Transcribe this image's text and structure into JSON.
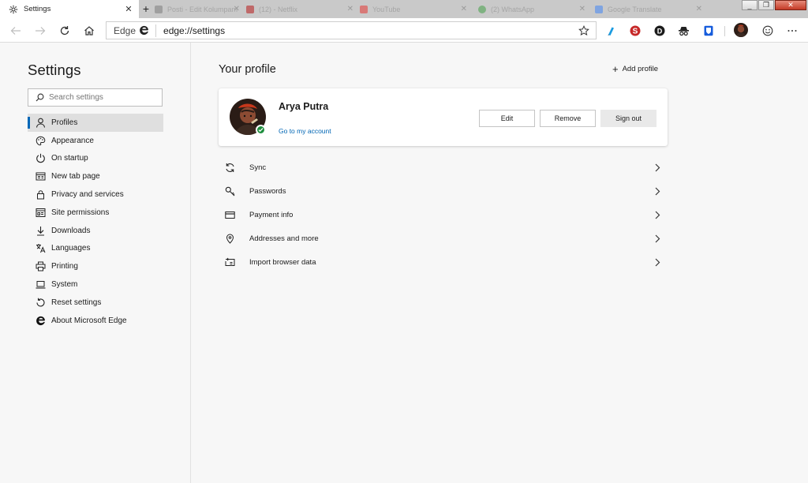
{
  "tabs": {
    "active": {
      "title": "Settings",
      "icon": "gear-icon"
    },
    "background": [
      {
        "title": "Posti - Edit Kolumpam",
        "color": "#7d7d7d"
      },
      {
        "title": "(12) - Netflix",
        "color": "#b71c1c"
      },
      {
        "title": "YouTube",
        "color": "#e53935"
      },
      {
        "title": "(2) WhatsApp",
        "color": "#43a047"
      },
      {
        "title": "Google Translate",
        "color": "#4285f4"
      }
    ]
  },
  "window_controls": {
    "minimize": "_",
    "maximize": "❐",
    "close": "✕"
  },
  "address_bar": {
    "brand": "Edge",
    "url": "edge://settings"
  },
  "sidebar": {
    "heading": "Settings",
    "search_placeholder": "Search settings",
    "items": [
      {
        "label": "Profiles",
        "icon": "person-icon",
        "active": true
      },
      {
        "label": "Appearance",
        "icon": "palette-icon"
      },
      {
        "label": "On startup",
        "icon": "power-icon"
      },
      {
        "label": "New tab page",
        "icon": "newtab-icon"
      },
      {
        "label": "Privacy and services",
        "icon": "lock-icon"
      },
      {
        "label": "Site permissions",
        "icon": "site-permissions-icon"
      },
      {
        "label": "Downloads",
        "icon": "download-icon"
      },
      {
        "label": "Languages",
        "icon": "languages-icon"
      },
      {
        "label": "Printing",
        "icon": "printer-icon"
      },
      {
        "label": "System",
        "icon": "laptop-icon"
      },
      {
        "label": "Reset settings",
        "icon": "reset-icon"
      },
      {
        "label": "About Microsoft Edge",
        "icon": "edge-logo-icon"
      }
    ]
  },
  "main": {
    "title": "Your profile",
    "add_profile": "Add profile",
    "profile": {
      "name": "Arya Putra",
      "link": "Go to my account",
      "buttons": {
        "edit": "Edit",
        "remove": "Remove",
        "signout": "Sign out"
      }
    },
    "rows": [
      {
        "label": "Sync",
        "icon": "sync-icon"
      },
      {
        "label": "Passwords",
        "icon": "key-icon"
      },
      {
        "label": "Payment info",
        "icon": "card-icon"
      },
      {
        "label": "Addresses and more",
        "icon": "location-icon"
      },
      {
        "label": "Import browser data",
        "icon": "import-icon"
      }
    ]
  },
  "colors": {
    "accent": "#0067b8",
    "link": "#0066b4",
    "success": "#1e8e3e"
  }
}
